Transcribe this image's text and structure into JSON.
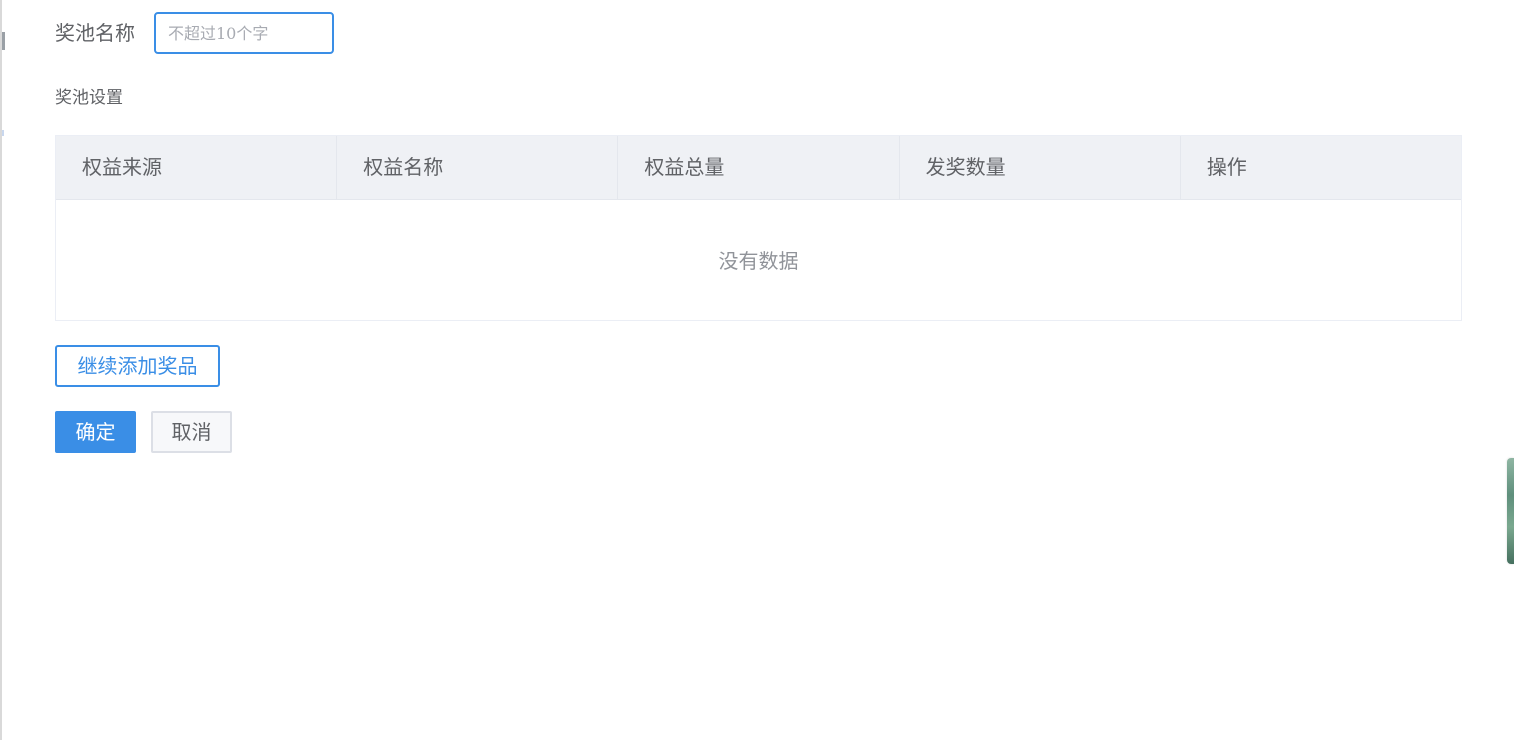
{
  "form": {
    "pool_name_label": "奖池名称",
    "pool_name_value": "",
    "pool_name_placeholder": "不超过10个字",
    "pool_settings_label": "奖池设置"
  },
  "table": {
    "columns": [
      "权益来源",
      "权益名称",
      "权益总量",
      "发奖数量",
      "操作"
    ],
    "rows": [],
    "empty_text": "没有数据"
  },
  "actions": {
    "add_prize_label": "继续添加奖品",
    "confirm_label": "确定",
    "cancel_label": "取消"
  },
  "colors": {
    "primary": "#3a8ee6",
    "header_bg": "#eff1f5",
    "text": "#606266",
    "muted": "#909399"
  }
}
